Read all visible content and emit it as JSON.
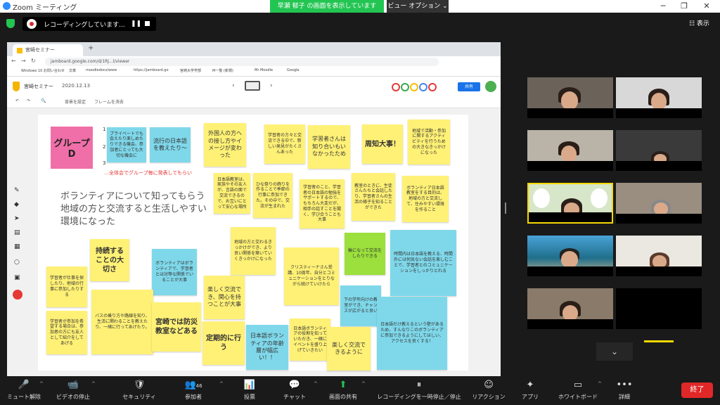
{
  "window": {
    "title": "Zoom ミーティング",
    "minimize": "─",
    "maximize": "❐",
    "close": "✕"
  },
  "banner": {
    "sharing_text": "早瀬 郁子 の画面を表示しています",
    "view_options": "ビュー オプション ⌄"
  },
  "recording": {
    "label": "レコーディングしています...",
    "pause": "❚❚"
  },
  "display_button": "☷ 表示",
  "browser": {
    "tab_title": "宮崎セミナー 2020.12.13 - Goo",
    "new_tab": "+",
    "url": "jamboard.google.com/d/1Rj...l/viewer",
    "nav": [
      "←",
      "→",
      "↻"
    ],
    "bookmarks": [
      "Windows 10 お問い合わせ",
      "文章",
      "moodledocs/www",
      "https://jamboard.go",
      "宮崎大学学部",
      "M一覧 (新規)",
      "Mr Moodle",
      "Google"
    ]
  },
  "jamboard": {
    "title": "宮崎セミナー",
    "date": "2020.12.13",
    "share_label": "共有",
    "sub_toolbar": [
      "↶",
      "↷",
      "🔍",
      "背景を設定",
      "フレームを消去"
    ],
    "frame_prev": "‹",
    "frame_next": "›"
  },
  "board": {
    "group_box": "グループD",
    "numbers": [
      "1",
      "2",
      "3"
    ],
    "red_note": "…全体会でグループ毎に発表してもらい",
    "big_line1": "ボランティアについて知ってもらう",
    "big_line2": "地域の方と交流すると生活しやすい",
    "big_line3": "環境になった",
    "stickies": [
      {
        "text": "プライベートでも会えたり楽しめたりできる機会、参加者にとっても大切な機会に",
        "color": "b"
      },
      {
        "text": "流行の日本語を教えたり〜",
        "color": "b"
      },
      {
        "text": "外国人の方への接し方やイメージが変わった",
        "color": "y"
      },
      {
        "text": "学習者の方々と交流できる中で、新しい発見がたくさんあった",
        "color": "y"
      },
      {
        "text": "学習者さんは知り合いもいなかったため",
        "color": "y"
      },
      {
        "text": "周知大事！",
        "color": "y"
      },
      {
        "text": "地域で活動・参加に関するアクティビティを行うための大きなきっかけになった",
        "color": "y"
      },
      {
        "text": "日本語教室は、家族やその友人が、言語の面で交流できるので、お互いにとって安心な場所",
        "color": "y"
      },
      {
        "text": "ひな祭りの飾りを作ることで季節の行事に参加できた。その中で、交流が生まれた",
        "color": "y"
      },
      {
        "text": "学習者のこと、学習者の日本語の勉強をサポートするので、もちろん大変だが、相手の話すことを聞く、学び合うことも大事",
        "color": "y"
      },
      {
        "text": "教室のときに、生徒さんたちと会話したり、学習者さんの生活の様子を知ることができた",
        "color": "y"
      },
      {
        "text": "ボランティア日本語教室をする目的は、地域の方と交流して、住みやすい環境を作ること",
        "color": "y"
      },
      {
        "text": "持続することの大切さ",
        "color": "y"
      },
      {
        "text": "地域の方と交わるきっかけができ、より良い関係を築いていくきっかけになった",
        "color": "y"
      },
      {
        "text": "輪になって交流をしたりできる",
        "color": "g"
      },
      {
        "text": "時間内は日本語を教える、時間外には何気ない会話を楽しむことで、学習者とのコミュニケーションをしっかりとれる",
        "color": "b"
      },
      {
        "text": "ボランティアはボランティアで、学習者とは対等な関係でいることが大事",
        "color": "b"
      },
      {
        "text": "クリスティーナさん受講、10周年、自分とコミュニケーションをとりながら続けていけたら",
        "color": "y"
      },
      {
        "text": "学習者が仕事を探したり、地域の行事に参加したりする",
        "color": "y"
      },
      {
        "text": "楽しく交流でき、関心を持つことが大事",
        "color": "y"
      },
      {
        "text": "下の学年向けの教室ができ、チャンスが広がると良い",
        "color": "b"
      },
      {
        "text": "日本語だけ教えるという壁があるため、すんなりこのボランティアに参加できるようにしてほしい、アクセスを良くする！",
        "color": "b"
      },
      {
        "text": "学習者が参加を希望する場合は、参加者の方にも友人として紹介をしてあげる",
        "color": "y"
      },
      {
        "text": "バスの乗り方や路線を知り、生活に関わることを教えたり、一緒に行ってあげたり。",
        "color": "y"
      },
      {
        "text": "宮崎では防災教室などある",
        "color": "y"
      },
      {
        "text": "定期的に行う",
        "color": "y"
      },
      {
        "text": "日本語ボランティアの年齢層が幅広い！！",
        "color": "b"
      },
      {
        "text": "日本語ボランティアの役割を知っていただき、一緒にイベントを盛り上げていきたい",
        "color": "y"
      },
      {
        "text": "楽しく交流できるように",
        "color": "y"
      }
    ]
  },
  "participants_count": "46",
  "toolbar": {
    "mute": "ミュート解除",
    "video": "ビデオの停止",
    "security": "セキュリティ",
    "participants": "参加者",
    "polls": "投票",
    "chat": "チャット",
    "share": "画面の共有",
    "recording": "レコーディングを一時停止／停止",
    "reactions": "リアクション",
    "apps": "アプリ",
    "whiteboard": "ホワイトボード",
    "more": "詳細",
    "end": "終了"
  },
  "icons": {
    "mic": "🎤",
    "video": "📹",
    "security": "🛡",
    "participants": "👥",
    "polls": "📊",
    "chat": "💬",
    "share": "⬆",
    "record": "⏸",
    "reactions": "☺",
    "apps": "✦",
    "whiteboard": "▭",
    "more": "•••",
    "chevron": "⌄"
  },
  "colors": {
    "share_green": "#23c552",
    "end_red": "#e02828",
    "sticky_yellow": "#fff176",
    "sticky_blue": "#7fd8ea",
    "sticky_green": "#9be03c",
    "group_pink": "#f06fa8"
  }
}
